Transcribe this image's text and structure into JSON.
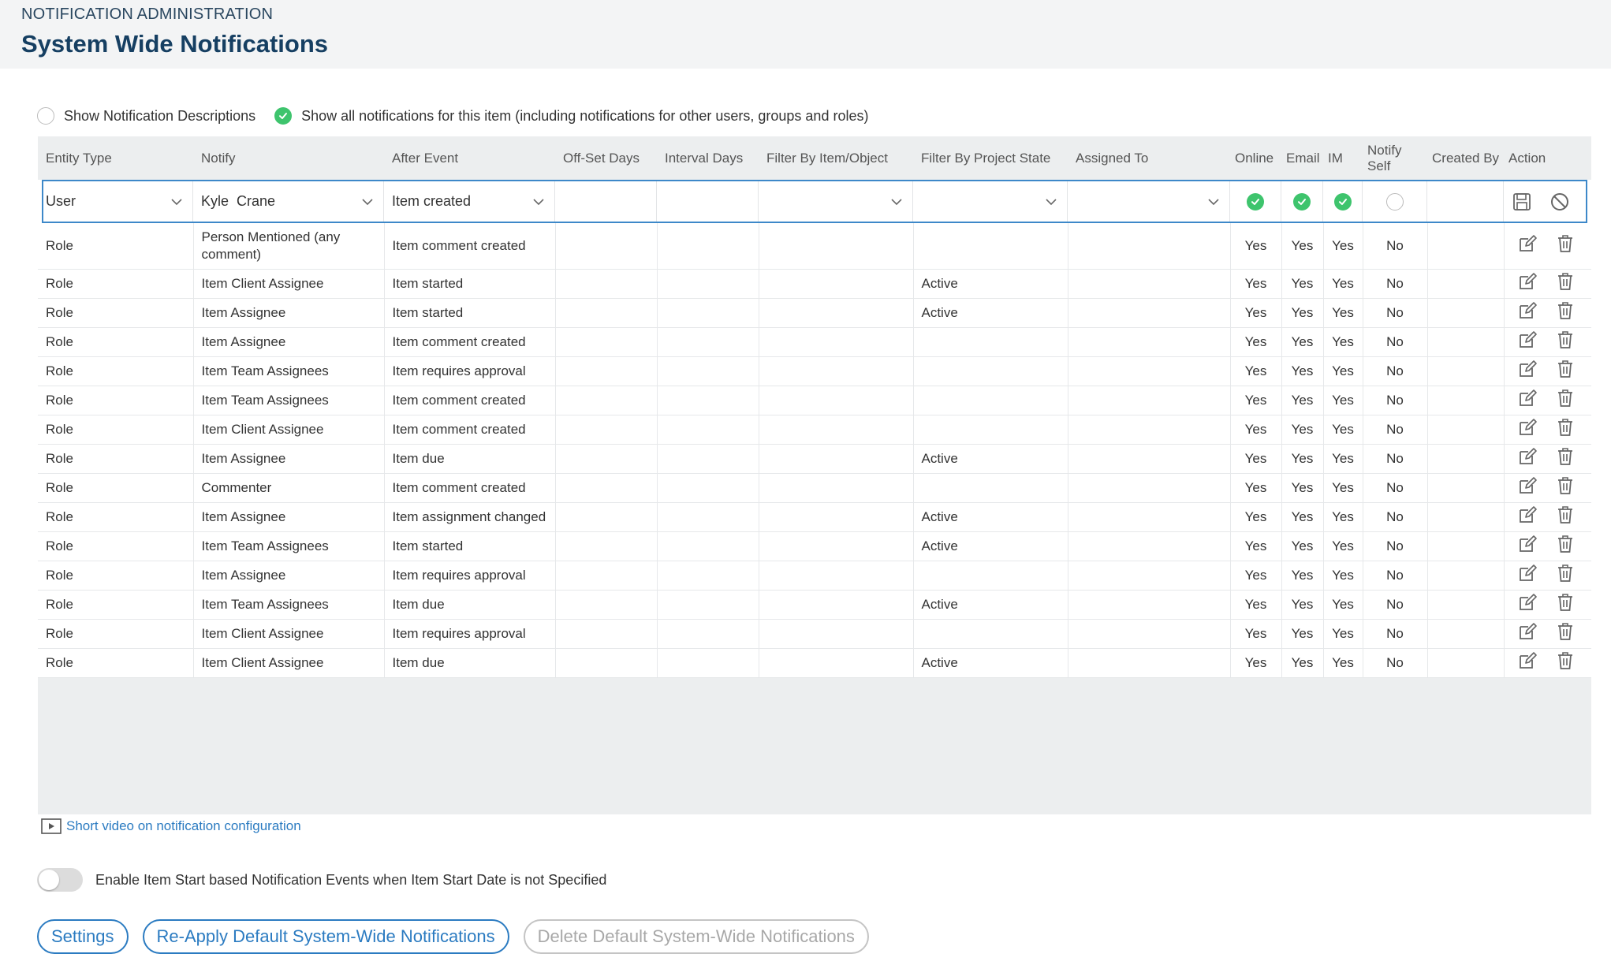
{
  "header": {
    "breadcrumb": "NOTIFICATION ADMINISTRATION",
    "title": "System Wide Notifications"
  },
  "options": {
    "show_descriptions": "Show Notification Descriptions",
    "show_all": "Show all notifications for this item (including notifications for other users, groups and roles)"
  },
  "table": {
    "columns": [
      "Entity Type",
      "Notify",
      "After Event",
      "Off-Set Days",
      "Interval Days",
      "Filter By Item/Object",
      "Filter By Project State",
      "Assigned To",
      "Online",
      "Email",
      "IM",
      "Notify Self",
      "Created By",
      "Action"
    ],
    "new_row": {
      "entity_type": "User",
      "notify": "Kyle  Crane",
      "after_event": "Item created"
    },
    "rows": [
      {
        "entity": "Role",
        "notify": "Person Mentioned (any comment)",
        "event": "Item comment created",
        "state": "",
        "online": "Yes",
        "email": "Yes",
        "im": "Yes",
        "self": "No"
      },
      {
        "entity": "Role",
        "notify": "Item Client Assignee",
        "event": "Item started",
        "state": "Active",
        "online": "Yes",
        "email": "Yes",
        "im": "Yes",
        "self": "No"
      },
      {
        "entity": "Role",
        "notify": "Item Assignee",
        "event": "Item started",
        "state": "Active",
        "online": "Yes",
        "email": "Yes",
        "im": "Yes",
        "self": "No"
      },
      {
        "entity": "Role",
        "notify": "Item Assignee",
        "event": "Item comment created",
        "state": "",
        "online": "Yes",
        "email": "Yes",
        "im": "Yes",
        "self": "No"
      },
      {
        "entity": "Role",
        "notify": "Item Team Assignees",
        "event": "Item requires approval",
        "state": "",
        "online": "Yes",
        "email": "Yes",
        "im": "Yes",
        "self": "No"
      },
      {
        "entity": "Role",
        "notify": "Item Team Assignees",
        "event": "Item comment created",
        "state": "",
        "online": "Yes",
        "email": "Yes",
        "im": "Yes",
        "self": "No"
      },
      {
        "entity": "Role",
        "notify": "Item Client Assignee",
        "event": "Item comment created",
        "state": "",
        "online": "Yes",
        "email": "Yes",
        "im": "Yes",
        "self": "No"
      },
      {
        "entity": "Role",
        "notify": "Item Assignee",
        "event": "Item due",
        "state": "Active",
        "online": "Yes",
        "email": "Yes",
        "im": "Yes",
        "self": "No"
      },
      {
        "entity": "Role",
        "notify": "Commenter",
        "event": "Item comment created",
        "state": "",
        "online": "Yes",
        "email": "Yes",
        "im": "Yes",
        "self": "No"
      },
      {
        "entity": "Role",
        "notify": "Item Assignee",
        "event": "Item assignment changed",
        "state": "Active",
        "online": "Yes",
        "email": "Yes",
        "im": "Yes",
        "self": "No"
      },
      {
        "entity": "Role",
        "notify": "Item Team Assignees",
        "event": "Item started",
        "state": "Active",
        "online": "Yes",
        "email": "Yes",
        "im": "Yes",
        "self": "No"
      },
      {
        "entity": "Role",
        "notify": "Item Assignee",
        "event": "Item requires approval",
        "state": "",
        "online": "Yes",
        "email": "Yes",
        "im": "Yes",
        "self": "No"
      },
      {
        "entity": "Role",
        "notify": "Item Team Assignees",
        "event": "Item due",
        "state": "Active",
        "online": "Yes",
        "email": "Yes",
        "im": "Yes",
        "self": "No"
      },
      {
        "entity": "Role",
        "notify": "Item Client Assignee",
        "event": "Item requires approval",
        "state": "",
        "online": "Yes",
        "email": "Yes",
        "im": "Yes",
        "self": "No"
      },
      {
        "entity": "Role",
        "notify": "Item Client Assignee",
        "event": "Item due",
        "state": "Active",
        "online": "Yes",
        "email": "Yes",
        "im": "Yes",
        "self": "No"
      }
    ]
  },
  "footer": {
    "video_link": "Short video on notification configuration",
    "toggle_label": "Enable Item Start based Notification Events when Item Start Date is not Specified",
    "settings_button": "Settings",
    "reapply_button": "Re-Apply Default System-Wide Notifications",
    "delete_button": "Delete Default System-Wide Notifications"
  },
  "colors": {
    "accent": "#2b7bc1",
    "title": "#163f62",
    "check": "#3ec46d"
  },
  "icons": [
    "check-icon",
    "chevron-down-icon",
    "save-icon",
    "cancel-icon",
    "edit-icon",
    "trash-icon",
    "video-icon"
  ]
}
